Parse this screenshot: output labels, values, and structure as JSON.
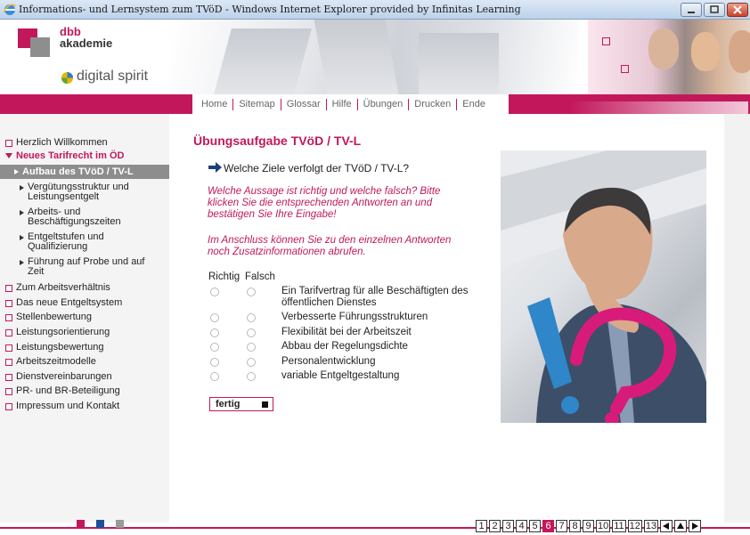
{
  "window": {
    "title": "Informations- und Lernsystem zum TVöD - Windows Internet Explorer provided by Infinitas Learning"
  },
  "logo": {
    "line1": "dbb",
    "line2": "akademie",
    "brand": "digital spirit"
  },
  "nav": {
    "items": [
      "Home",
      "Sitemap",
      "Glossar",
      "Hilfe",
      "Übungen",
      "Drucken",
      "Ende"
    ]
  },
  "sidebar": {
    "herzlich": "Herzlich Willkommen",
    "neues": "Neues Tarifrecht im ÖD",
    "aufbau": "Aufbau des TVöD / TV-L",
    "verguetung": "Vergütungsstruktur und Leistungsentgelt",
    "arbeits": "Arbeits- und Beschäftigungszeiten",
    "entgeltstufen": "Entgeltstufen und Qualifizierung",
    "fuehrung": "Führung auf Probe und auf Zeit",
    "zum_arbeit": "Zum Arbeitsverhältnis",
    "entgeltsystem": "Das neue Entgeltsystem",
    "stellen": "Stellenbewertung",
    "leistungsorient": "Leistungsorientierung",
    "leistungsbew": "Leistungsbewertung",
    "arbeitszeit": "Arbeitszeitmodelle",
    "dienst": "Dienstvereinbarungen",
    "pr": "PR- und BR-Beteiligung",
    "impressum": "Impressum und Kontakt"
  },
  "main": {
    "title": "Übungsaufgabe TVöD / TV-L",
    "question": "Welche Ziele verfolgt der TVöD / TV-L?",
    "instruction": "Welche Aussage ist richtig und welche falsch? Bitte klicken Sie die entsprechenden Antworten an und bestätigen Sie Ihre Eingabe!",
    "followup": "Im Anschluss können Sie zu den einzelnen Antworten noch Zusatzinformationen abrufen.",
    "col_richtig": "Richtig",
    "col_falsch": "Falsch",
    "answers": [
      "Ein Tarifvertrag für alle Beschäftigten des öffentlichen Dienstes",
      "Verbesserte Führungsstrukturen",
      "Flexibilität bei der Arbeitszeit",
      "Abbau der Regelungsdichte",
      "Personalentwicklung",
      "variable Entgeltgestaltung"
    ],
    "submit": "fertig"
  },
  "pager": {
    "pages": [
      "1",
      "2",
      "3",
      "4",
      "5",
      "6",
      "7",
      "8",
      "9",
      "10",
      "11",
      "12",
      "13"
    ],
    "active": "6"
  },
  "colors": {
    "accent": "#c2185b",
    "sidebar_active": "#8d8d8d"
  }
}
